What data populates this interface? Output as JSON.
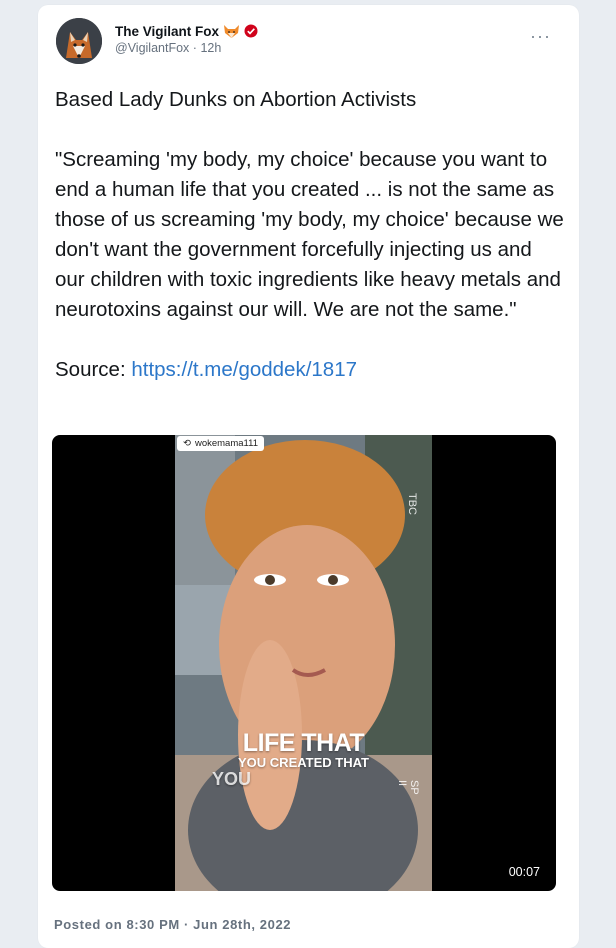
{
  "author": {
    "name": "The Vigilant Fox",
    "handle": "@VigilantFox",
    "separator": "·",
    "time_ago": "12h",
    "name_emoji": "fox-face-icon",
    "badge": "verified-icon"
  },
  "menu": {
    "more_label": "···"
  },
  "tweet": {
    "headline": "Based Lady Dunks on Abortion Activists",
    "quote": "\"Screaming 'my body, my choice' because you want to end a human life that you created ... is not the same as those of us screaming 'my body, my choice' because we don't want the government forcefully injecting us and our children with toxic ingredients like heavy metals and neurotoxins against our will. We are not the same.\"",
    "source_label": "Source:",
    "source_url": "https://t.me/goddek/1817"
  },
  "video": {
    "repost_user": "wokemama111",
    "caption_line1": "LIFE THAT",
    "caption_line2": "YOU CREATED THAT",
    "caption_line3": "YOU",
    "side_text_top": "TBC",
    "side_text_bottom": "SP II",
    "duration": "00:07"
  },
  "footer": {
    "posted": "Posted on 8:30 PM · Jun 28th, 2022"
  },
  "colors": {
    "link": "#2c77c9",
    "background": "#e9edf2",
    "verified_badge": "#d0021b"
  }
}
